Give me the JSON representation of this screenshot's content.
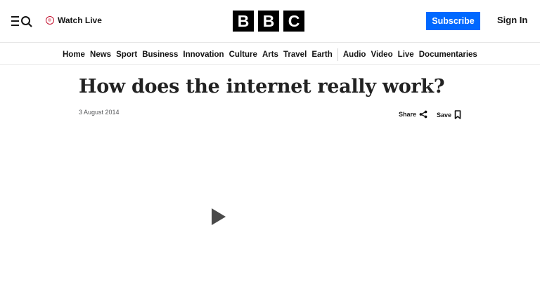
{
  "header": {
    "watch_live_label": "Watch Live",
    "logo_letters": [
      "B",
      "B",
      "C"
    ],
    "subscribe_label": "Subscribe",
    "signin_label": "Sign In"
  },
  "nav": {
    "items": [
      "Home",
      "News",
      "Sport",
      "Business",
      "Innovation",
      "Culture",
      "Arts",
      "Travel",
      "Earth",
      "Audio",
      "Video",
      "Live",
      "Documentaries"
    ]
  },
  "article": {
    "title": "How does the internet really work?",
    "date": "3 August 2014",
    "share_label": "Share",
    "save_label": "Save"
  },
  "icons": {
    "menu": "menu-search-icon",
    "live": "live-dot-icon",
    "share": "share-icon",
    "save": "bookmark-icon",
    "play": "play-icon"
  },
  "colors": {
    "brand_black": "#000000",
    "subscribe_blue": "#0068ff",
    "live_red": "#c4122f",
    "text": "#141414"
  }
}
